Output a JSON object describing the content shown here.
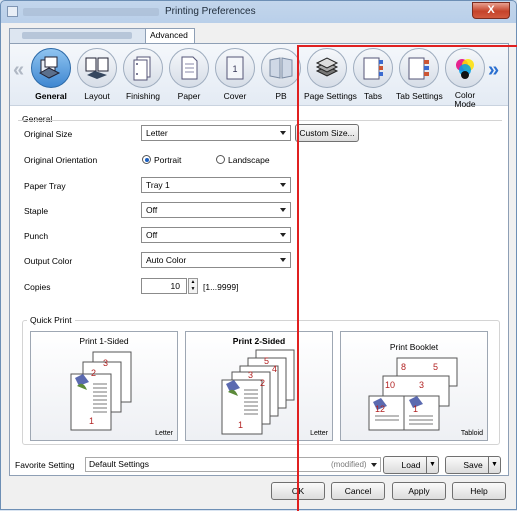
{
  "window": {
    "title": "Printing Preferences",
    "close_label": "X"
  },
  "tabs": [
    {
      "label": ""
    },
    {
      "label": "Advanced"
    }
  ],
  "iconbar": {
    "items": [
      {
        "label": "General",
        "selected": true
      },
      {
        "label": "Layout"
      },
      {
        "label": "Finishing"
      },
      {
        "label": "Paper"
      },
      {
        "label": "Cover"
      },
      {
        "label": "PB"
      },
      {
        "label": "Page Settings"
      },
      {
        "label": "Tabs"
      },
      {
        "label": "Tab Settings"
      },
      {
        "label": "Color\nMode"
      }
    ]
  },
  "general": {
    "section_label": "General",
    "original_size": {
      "label": "Original Size",
      "value": "Letter",
      "custom_button": "Custom Size..."
    },
    "orientation": {
      "label": "Original Orientation",
      "portrait": "Portrait",
      "landscape": "Landscape",
      "selected": "Portrait"
    },
    "paper_tray": {
      "label": "Paper Tray",
      "value": "Tray 1"
    },
    "staple": {
      "label": "Staple",
      "value": "Off"
    },
    "punch": {
      "label": "Punch",
      "value": "Off"
    },
    "output_color": {
      "label": "Output Color",
      "value": "Auto Color"
    },
    "copies": {
      "label": "Copies",
      "value": "10",
      "range": "[1...9999]"
    }
  },
  "quick_print": {
    "label": "Quick Print",
    "cards": [
      {
        "title": "Print 1-Sided",
        "paper": "Letter",
        "pages": [
          "3",
          "2",
          "1"
        ]
      },
      {
        "title": "Print 2-Sided",
        "paper": "Letter",
        "pages": [
          "5",
          "4",
          "3",
          "2",
          "1"
        ]
      },
      {
        "title": "Print Booklet",
        "paper": "Tabloid",
        "pages": [
          "8",
          "5",
          "10",
          "3",
          "12",
          "1"
        ]
      }
    ]
  },
  "favorite": {
    "label": "Favorite Setting",
    "value": "Default Settings",
    "status": "(modified)",
    "load": "Load",
    "save": "Save"
  },
  "footer": {
    "ok": "OK",
    "cancel": "Cancel",
    "apply": "Apply",
    "help": "Help"
  },
  "colors": {
    "selected_tab": "#3f87d1",
    "annotation_line": "#e02020"
  }
}
